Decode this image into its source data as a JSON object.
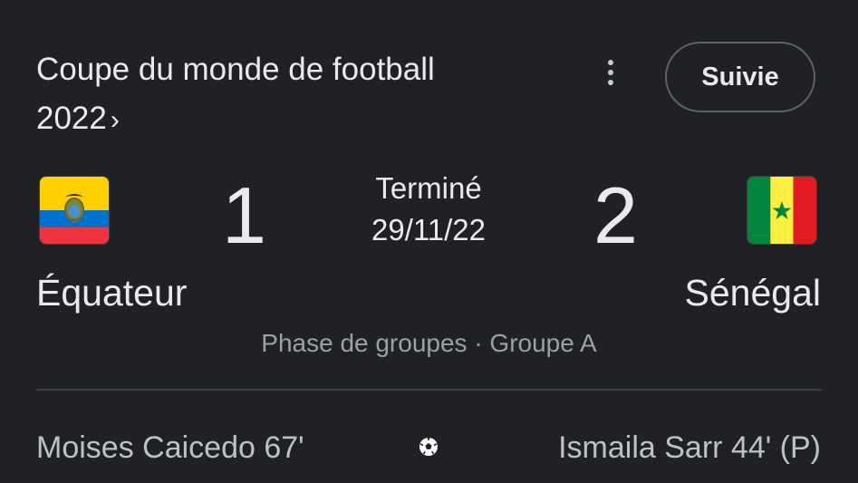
{
  "header": {
    "title_line1": "Coupe du monde de football",
    "title_line2": "2022",
    "title_chevron": "›",
    "more_icon": "more-vert-icon",
    "follow_label": "Suivie"
  },
  "match": {
    "status": "Terminé",
    "date": "29/11/22",
    "stage": "Phase de groupes · Groupe A",
    "home": {
      "name": "Équateur",
      "score": "1",
      "flag_icon": "ecuador-flag-icon",
      "colors": [
        "#FFD100",
        "#0072CE",
        "#EF3340"
      ]
    },
    "away": {
      "name": "Sénégal",
      "score": "2",
      "flag_icon": "senegal-flag-icon",
      "colors": [
        "#00853F",
        "#FDEF42",
        "#E31B23"
      ]
    }
  },
  "goals": {
    "icon": "soccer-ball-icon",
    "home_scorers": "Moises Caicedo 67'",
    "away_scorers": "Ismaila Sarr 44' (P)"
  },
  "colors": {
    "background": "#202124",
    "text_primary": "#e8eaed",
    "text_secondary": "#9aa0a6",
    "divider": "#3c4043"
  }
}
